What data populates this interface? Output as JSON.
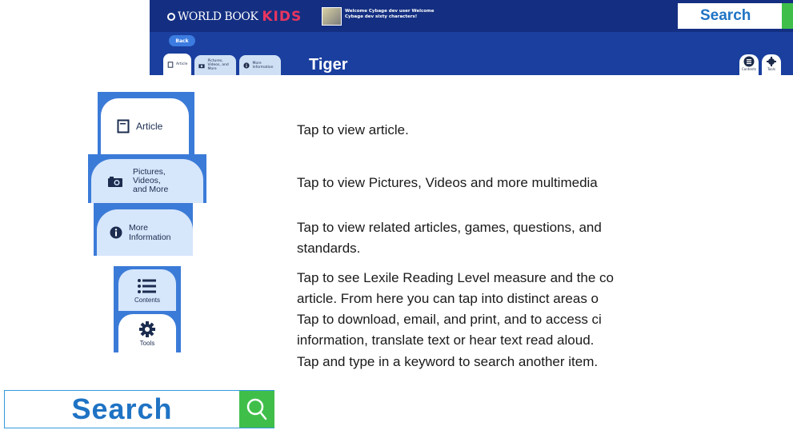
{
  "header": {
    "logo_world": "WORLD BOOK",
    "logo_kids": "KIDS",
    "welcome_line1": "Welcome Cybage dev user Welcome",
    "welcome_line2": "Cybage dev sixty characters!",
    "search_label": "Search",
    "back_label": "Back",
    "tabs": [
      {
        "label": "Article",
        "icon": "article-icon"
      },
      {
        "label": "Pictures, Videos, and More",
        "icon": "camera-icon"
      },
      {
        "label": "More Information",
        "icon": "info-icon"
      }
    ],
    "title": "Tiger",
    "contents_label": "Contents",
    "tools_label": "Tools"
  },
  "legend": [
    {
      "id": "article",
      "label": "Article",
      "icon": "article-icon",
      "description": "Tap to view article."
    },
    {
      "id": "pictures",
      "label_lines": [
        "Pictures,",
        "Videos,",
        "and More"
      ],
      "icon": "camera-icon",
      "description": "Tap to view Pictures, Videos and more multimedia"
    },
    {
      "id": "more-info",
      "label_lines": [
        "More",
        "Information"
      ],
      "icon": "info-icon",
      "description_lines": [
        "Tap to view related articles, games, questions, and",
        "standards."
      ]
    },
    {
      "id": "contents",
      "label": "Contents",
      "icon": "list-icon",
      "description_lines": [
        "Tap to see Lexile Reading Level measure and the co",
        "article. From here you can tap into distinct areas o"
      ]
    },
    {
      "id": "tools",
      "label": "Tools",
      "icon": "gear-icon",
      "description_lines": [
        "Tap to download, email, and print, and to access ci",
        "information, translate text or hear text read aloud."
      ]
    },
    {
      "id": "search",
      "label": "Search",
      "icon": "search-icon",
      "description": "Tap and type in a keyword to search another item."
    }
  ],
  "colors": {
    "header_blue": "#1a3f9e",
    "tile_blue": "#3b7bd8",
    "tab_light": "#d6e6fb",
    "search_text": "#1f73c4",
    "search_green": "#3fbf4a",
    "kids_pink": "#e8355f"
  }
}
